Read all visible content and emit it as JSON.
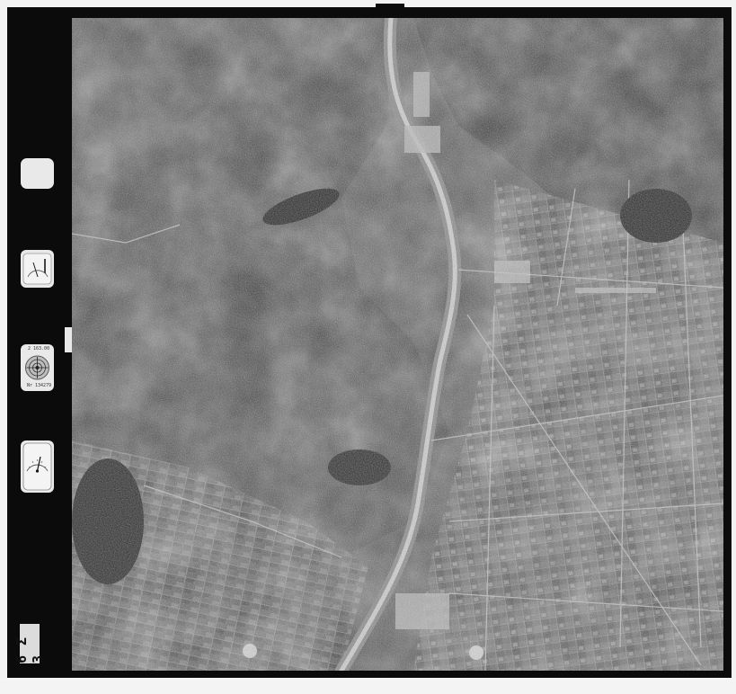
{
  "image": {
    "kind": "aerial photograph",
    "palette": [
      "#0b0b0b",
      "#4a4a4a",
      "#8a8a8a",
      "#d8d8d8"
    ]
  },
  "side_panel": {
    "level_card_top_text": "2 163.00",
    "level_card_bottom_text": "Nr 134279",
    "frame_number": "6 Σ 3"
  }
}
